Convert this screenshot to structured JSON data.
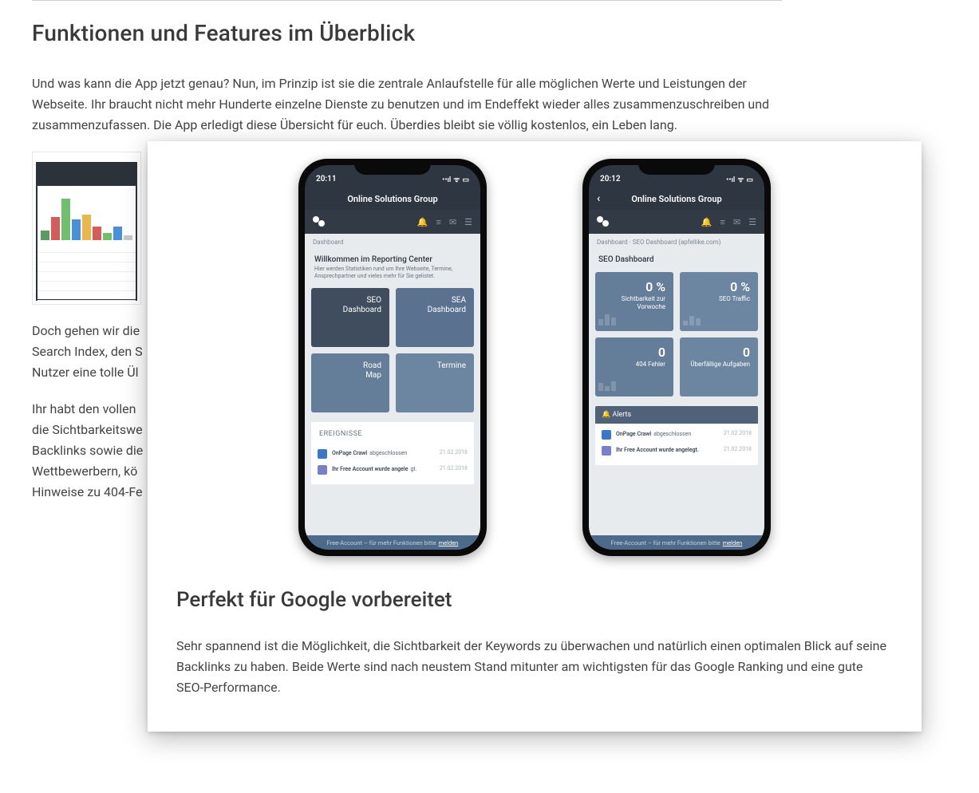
{
  "back": {
    "heading": "Funktionen und Features im Überblick",
    "p1": "Und was kann die App jetzt genau? Nun, im Prinzip ist sie die zentrale Anlaufstelle für alle möglichen Werte und Leistungen der Webseite. Ihr braucht nicht mehr Hunderte einzelne Dienste zu benutzen und im Endeffekt wieder alles zusammenzuschreiben und zusammenzufassen. Die App erledigt diese Übersicht für euch. Überdies bleibt sie völlig kostenlos, ein Leben lang.",
    "p2": "Doch gehen wir die",
    "p2b": "Search Index, den S",
    "p2c": "Nutzer eine tolle Ül",
    "p3": "Ihr habt den vollen",
    "p3b": "die Sichtbarkeitswe",
    "p3c": "Backlinks sowie die",
    "p3d": "Wettbewerbern, kö",
    "p3e": "Hinweise zu 404-Fe"
  },
  "overlay": {
    "heading": "Perfekt für Google vorbereitet",
    "p": "Sehr spannend ist die Möglichkeit, die Sichtbarkeit der Keywords zu überwachen und natürlich einen optimalen Blick auf seine Backlinks zu haben. Beide Werte sind nach neustem Stand mitunter am wichtigsten für das Google Ranking und eine gute SEO-Performance."
  },
  "phoneA": {
    "time": "20:11",
    "brand": "Online Solutions Group",
    "crumb": "Dashboard",
    "welcome_t": "Willkommen im Reporting Center",
    "welcome_s": "Hier werden Statistiken rund um Ihre Webseite, Termine, Ansprechpartner und vieles mehr für Sie gelistet.",
    "tiles": [
      {
        "l1": "SEO",
        "l2": "Dashboard"
      },
      {
        "l1": "SEA",
        "l2": "Dashboard"
      },
      {
        "l1": "Road",
        "l2": "Map"
      },
      {
        "l1": "Termine",
        "l2": ""
      }
    ],
    "section": "EREIGNISSE",
    "events": [
      {
        "b": "OnPage Crawl",
        "t": "abgeschlossen",
        "d": "21.02.2018"
      },
      {
        "b": "Ihr Free Account wurde angele",
        "t": "gt.",
        "d": "21.02.2018"
      }
    ],
    "footer_a": "Free-Account – für mehr Funktionen bitte",
    "footer_b": "melden"
  },
  "phoneB": {
    "time": "20:12",
    "brand": "Online Solutions Group",
    "crumb": "Dashboard  ·  SEO Dashboard (apfellike.com)",
    "title": "SEO Dashboard",
    "tiles": [
      {
        "big": "0 %",
        "sub": "Sichtbarkeit zur Vorwoche"
      },
      {
        "big": "0 %",
        "sub": "SEO Traffic"
      },
      {
        "big": "0",
        "sub": "404 Fehler"
      },
      {
        "big": "0",
        "sub": "Überfällige Aufgaben"
      }
    ],
    "alerts_h": "Alerts",
    "events": [
      {
        "b": "OnPage Crawl",
        "t": "abgeschlossen",
        "d": "21.02.2018"
      },
      {
        "b": "Ihr Free Account wurde angelegt.",
        "t": "",
        "d": "21.02.2018"
      }
    ],
    "footer_a": "Free-Account – für mehr Funktionen bitte",
    "footer_b": "melden"
  },
  "chart_data": {
    "type": "bar",
    "note": "decorative thumbnail bar chart, values are relative heights as seen",
    "values": [
      20,
      50,
      90,
      45,
      55,
      30,
      15,
      30,
      10
    ],
    "colors": [
      "green",
      "red",
      "green",
      "blue",
      "yellow",
      "red",
      "green",
      "blue",
      "grey"
    ]
  }
}
